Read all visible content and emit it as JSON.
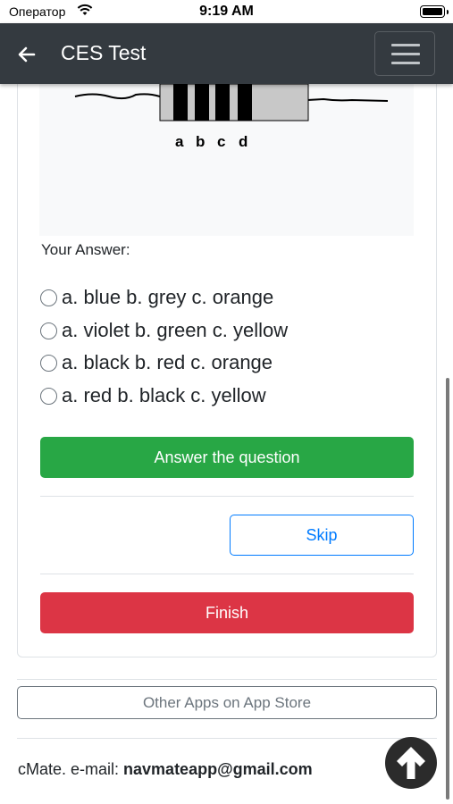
{
  "status_bar": {
    "carrier": "Оператор",
    "time": "9:19 AM"
  },
  "navbar": {
    "title": "CES Test"
  },
  "question_image": {
    "band_labels": [
      "a",
      "b",
      "c",
      "d"
    ]
  },
  "answer_section": {
    "label": "Your Answer:",
    "options": [
      "a. blue b. grey c. orange",
      "a. violet b. green c. yellow",
      "a. black b. red c. orange",
      "a. red b. black c. yellow"
    ]
  },
  "buttons": {
    "answer": "Answer the question",
    "skip": "Skip",
    "finish": "Finish",
    "other_apps": "Other Apps on App Store"
  },
  "footer": {
    "prefix": "cMate. e-mail: ",
    "email": "navmateapp@gmail.com"
  },
  "colors": {
    "navbar": "#343a40",
    "success": "#28a745",
    "primary": "#007bff",
    "danger": "#dc3545"
  }
}
